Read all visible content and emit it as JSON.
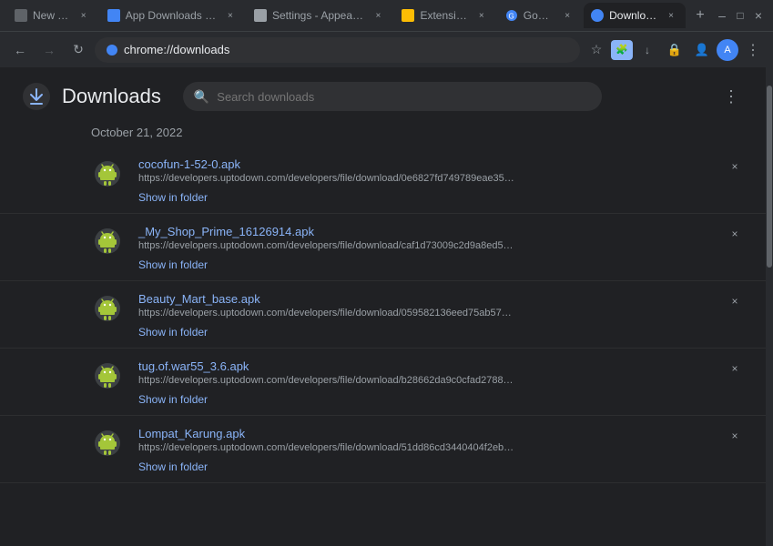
{
  "browser": {
    "tabs": [
      {
        "id": "new-tab",
        "label": "New Tab",
        "favicon_type": "new-tab",
        "active": false
      },
      {
        "id": "app-downloads",
        "label": "App Downloads fo…",
        "favicon_type": "app",
        "active": false
      },
      {
        "id": "settings",
        "label": "Settings - Appeara…",
        "favicon_type": "settings",
        "active": false
      },
      {
        "id": "extensions",
        "label": "Extensions",
        "favicon_type": "extensions",
        "active": false
      },
      {
        "id": "google",
        "label": "Google",
        "favicon_type": "google",
        "active": false
      },
      {
        "id": "downloads",
        "label": "Downloads",
        "favicon_type": "downloads",
        "active": true
      }
    ],
    "new_tab_button": "+",
    "window_controls": {
      "minimize": "–",
      "maximize": "□",
      "close": "×"
    }
  },
  "toolbar": {
    "back_disabled": false,
    "forward_disabled": true,
    "refresh_label": "↻",
    "address": "chrome://downloads",
    "address_prefix": "chrome://",
    "address_path": "downloads",
    "bookmark_icon": "☆",
    "profile_initial": "A"
  },
  "page": {
    "logo_char": "↓",
    "title": "Downloads",
    "search_placeholder": "Search downloads",
    "more_options_label": "⋮",
    "date_section": "October 21, 2022",
    "items": [
      {
        "id": "item-1",
        "filename": "cocofun-1-52-0.apk",
        "url": "https://developers.uptodown.com/developers/file/download/0e6827fd749789eae35…",
        "action": "Show in folder"
      },
      {
        "id": "item-2",
        "filename": "_My_Shop_Prime_16126914.apk",
        "url": "https://developers.uptodown.com/developers/file/download/caf1d73009c2d9a8ed5…",
        "action": "Show in folder"
      },
      {
        "id": "item-3",
        "filename": "Beauty_Mart_base.apk",
        "url": "https://developers.uptodown.com/developers/file/download/059582136eed75ab57…",
        "action": "Show in folder"
      },
      {
        "id": "item-4",
        "filename": "tug.of.war55_3.6.apk",
        "url": "https://developers.uptodown.com/developers/file/download/b28662da9c0cfad2788…",
        "action": "Show in folder"
      },
      {
        "id": "item-5",
        "filename": "Lompat_Karung.apk",
        "url": "https://developers.uptodown.com/developers/file/download/51dd86cd3440404f2eb…",
        "action": "Show in folder"
      }
    ]
  }
}
